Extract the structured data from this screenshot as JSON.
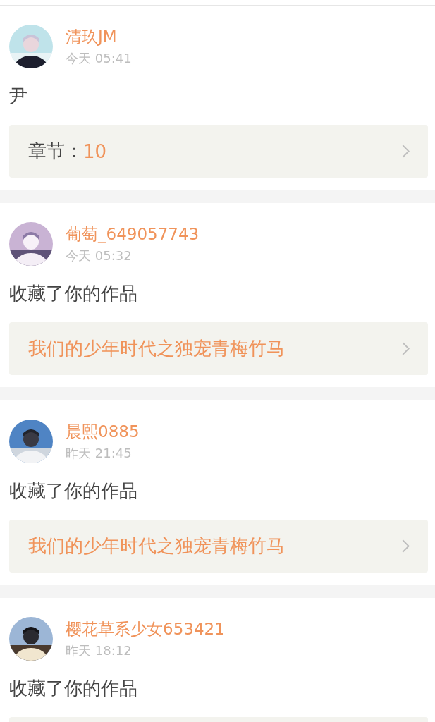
{
  "notifications": [
    {
      "user": "清玖JM",
      "time": "今天 05:41",
      "message": "尹",
      "link": {
        "kind": "chapter",
        "label": "章节：",
        "value": "10"
      }
    },
    {
      "user": "葡萄_649057743",
      "time": "今天 05:32",
      "message": "收藏了你的作品",
      "link": {
        "kind": "work",
        "title": "我们的少年时代之独宠青梅竹马"
      }
    },
    {
      "user": "晨熙0885",
      "time": "昨天 21:45",
      "message": "收藏了你的作品",
      "link": {
        "kind": "work",
        "title": "我们的少年时代之独宠青梅竹马"
      }
    },
    {
      "user": "樱花草系少女653421",
      "time": "昨天 18:12",
      "message": "收藏了你的作品",
      "link": {
        "kind": "blank"
      }
    }
  ]
}
